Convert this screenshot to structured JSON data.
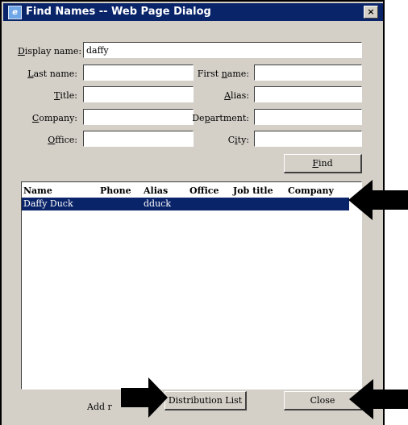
{
  "window": {
    "title": "Find Names -- Web Page Dialog",
    "icon": "ie-icon",
    "close_symbol": "×"
  },
  "form": {
    "display_name": {
      "label_u": "D",
      "label_rest": "isplay name:",
      "value": "daffy"
    },
    "last_name": {
      "label_u": "L",
      "label_rest": "ast name:",
      "value": ""
    },
    "first_name": {
      "label_pre": "First ",
      "label_u": "n",
      "label_rest": "ame:",
      "value": ""
    },
    "title": {
      "label_u": "T",
      "label_rest": "itle:",
      "value": ""
    },
    "alias": {
      "label_u": "A",
      "label_rest": "lias:",
      "value": ""
    },
    "company": {
      "label_u": "C",
      "label_rest": "ompany:",
      "value": ""
    },
    "department": {
      "label_pre": "De",
      "label_u": "p",
      "label_rest": "artment:",
      "value": ""
    },
    "office": {
      "label_u": "O",
      "label_rest": "ffice:",
      "value": ""
    },
    "city": {
      "label_pre": "C",
      "label_u": "i",
      "label_rest": "ty:",
      "value": ""
    }
  },
  "buttons": {
    "find_u": "F",
    "find_rest": "ind",
    "distribution_list": "Distribution List",
    "close": "Close",
    "add_to_prefix": "Add r"
  },
  "results": {
    "columns": [
      "Name",
      "Phone",
      "Alias",
      "Office",
      "Job title",
      "Company"
    ],
    "rows": [
      {
        "name": "Daffy Duck",
        "phone": "",
        "alias": "dduck",
        "office": "",
        "job_title": "",
        "company": "",
        "selected": true
      }
    ]
  },
  "colors": {
    "titlebar": "#0a246a",
    "selection": "#0a246a",
    "dialog_face": "#d4d0c8",
    "arrow": "#000000"
  }
}
